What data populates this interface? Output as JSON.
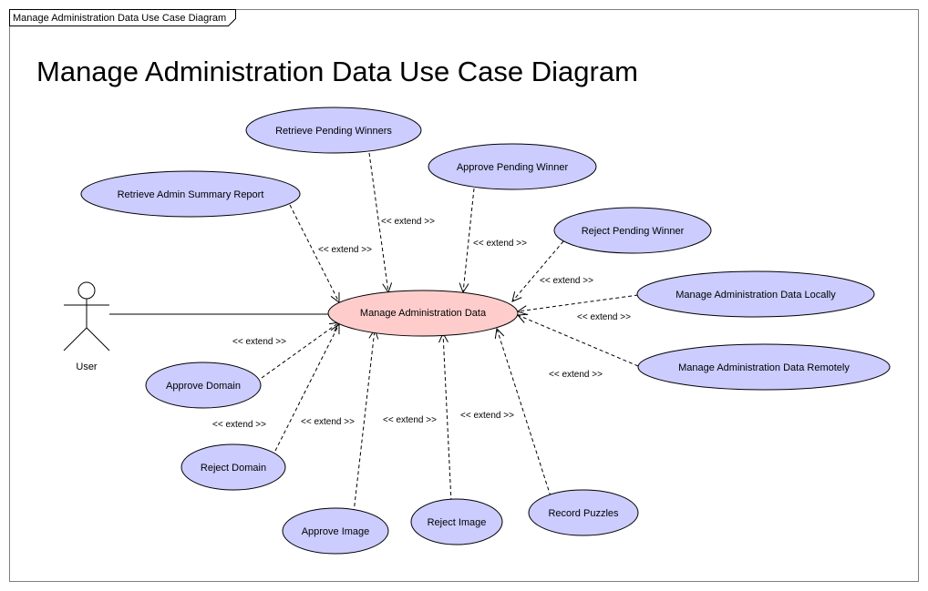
{
  "frame": {
    "tab_label": "Manage Administration Data Use Case Diagram"
  },
  "title": "Manage Administration Data Use Case Diagram",
  "colors": {
    "use_case_fill": "#ccccff",
    "main_use_case_fill": "#ffcccc",
    "stroke": "#000000",
    "frame_stroke": "#808080"
  },
  "actor": {
    "name": "User"
  },
  "main_use_case": {
    "label": "Manage Administration Data"
  },
  "use_cases": [
    {
      "id": "retrieve-pending-winners",
      "label": "Retrieve Pending Winners"
    },
    {
      "id": "approve-pending-winner",
      "label": "Approve Pending Winner"
    },
    {
      "id": "retrieve-admin-summary-report",
      "label": "Retrieve Admin Summary Report"
    },
    {
      "id": "reject-pending-winner",
      "label": "Reject Pending Winner"
    },
    {
      "id": "manage-administration-data-locally",
      "label": "Manage Administration Data Locally"
    },
    {
      "id": "manage-administration-data-remotely",
      "label": "Manage Administration Data Remotely"
    },
    {
      "id": "approve-domain",
      "label": "Approve Domain"
    },
    {
      "id": "reject-domain",
      "label": "Reject Domain"
    },
    {
      "id": "approve-image",
      "label": "Approve Image"
    },
    {
      "id": "reject-image",
      "label": "Reject Image"
    },
    {
      "id": "record-puzzles",
      "label": "Record Puzzles"
    }
  ],
  "relationship_label": "<< extend >>"
}
